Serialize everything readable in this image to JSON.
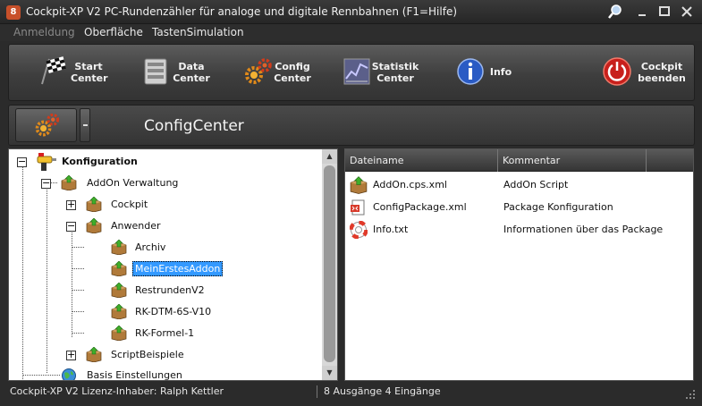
{
  "window": {
    "title": "Cockpit-XP V2 PC-Rundenzähler für analoge und digitale Rennbahnen (F1=Hilfe)",
    "app_icon_text": "8"
  },
  "menu": {
    "items": [
      {
        "label": "Anmeldung",
        "enabled": false
      },
      {
        "label": "Oberfläche",
        "enabled": true
      },
      {
        "label": "TastenSimulation",
        "enabled": true
      }
    ]
  },
  "toolbar": {
    "buttons": [
      {
        "label": "Start\nCenter",
        "icon": "checkered-flag-icon"
      },
      {
        "label": "Data\nCenter",
        "icon": "server-icon"
      },
      {
        "label": "Config\nCenter",
        "icon": "gears-icon"
      },
      {
        "label": "Statistik\nCenter",
        "icon": "chart-icon"
      },
      {
        "label": "Info",
        "icon": "info-icon"
      },
      {
        "label": "Cockpit\nbeenden",
        "icon": "power-icon"
      }
    ]
  },
  "config_header": {
    "title": "ConfigCenter"
  },
  "tree": {
    "items": [
      {
        "label": "Konfiguration",
        "bold": true,
        "selected": false,
        "icon": "drill-icon"
      },
      {
        "label": "AddOn Verwaltung",
        "bold": false,
        "selected": false,
        "icon": "box-icon"
      },
      {
        "label": "Cockpit",
        "bold": false,
        "selected": false,
        "icon": "box-icon"
      },
      {
        "label": "Anwender",
        "bold": false,
        "selected": false,
        "icon": "box-icon"
      },
      {
        "label": "Archiv",
        "bold": false,
        "selected": false,
        "icon": "box-icon"
      },
      {
        "label": "MeinErstesAddon",
        "bold": false,
        "selected": true,
        "icon": "box-icon"
      },
      {
        "label": "RestrundenV2",
        "bold": false,
        "selected": false,
        "icon": "box-icon"
      },
      {
        "label": "RK-DTM-6S-V10",
        "bold": false,
        "selected": false,
        "icon": "box-icon"
      },
      {
        "label": "RK-Formel-1",
        "bold": false,
        "selected": false,
        "icon": "box-icon"
      },
      {
        "label": "ScriptBeispiele",
        "bold": false,
        "selected": false,
        "icon": "box-icon"
      },
      {
        "label": "Basis Einstellungen",
        "bold": false,
        "selected": false,
        "icon": "globe-icon"
      }
    ]
  },
  "files": {
    "columns": [
      "Dateiname",
      "Kommentar"
    ],
    "rows": [
      {
        "name": "AddOn.cps.xml",
        "comment": "AddOn Script",
        "icon": "box-icon"
      },
      {
        "name": "ConfigPackage.xml",
        "comment": "Package Konfiguration",
        "icon": "xml-file-icon"
      },
      {
        "name": "Info.txt",
        "comment": "Informationen über das Package",
        "icon": "lifebuoy-icon"
      }
    ]
  },
  "status": {
    "left": "Cockpit-XP V2 Lizenz-Inhaber: Ralph Kettler",
    "right": "8 Ausgänge 4 Eingänge"
  }
}
